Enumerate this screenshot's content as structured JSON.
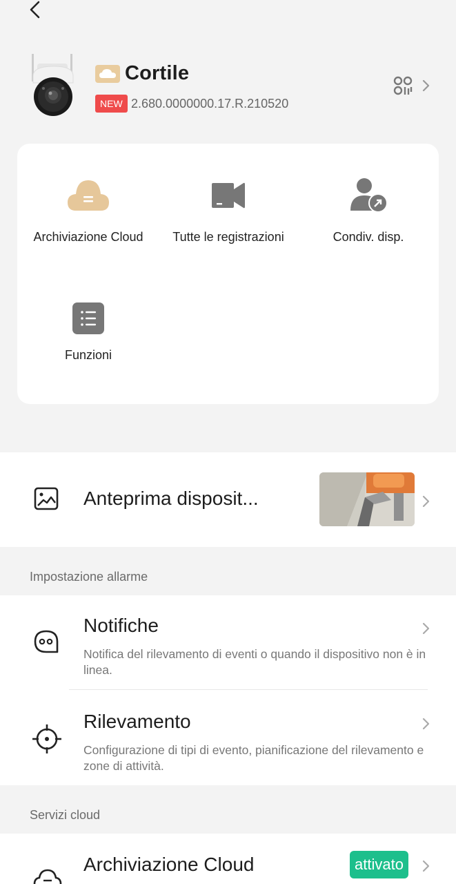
{
  "header": {
    "device_name": "Cortile",
    "new_badge": "NEW",
    "firmware_version": "2.680.0000000.17.R.210520"
  },
  "features": [
    {
      "label": "Archiviazione Cloud",
      "icon": "cloud-icon"
    },
    {
      "label": "Tutte le registrazioni",
      "icon": "video-icon"
    },
    {
      "label": "Condiv. disp.",
      "icon": "share-user-icon"
    },
    {
      "label": "Funzioni",
      "icon": "list-icon"
    }
  ],
  "preview": {
    "label": "Anteprima disposit..."
  },
  "alarm_section": {
    "title": "Impostazione allarme",
    "items": [
      {
        "title": "Notifiche",
        "subtitle": "Notifica del rilevamento di eventi o quando il dispositivo non è in linea.",
        "icon": "chat-face-icon"
      },
      {
        "title": "Rilevamento",
        "subtitle": "Configurazione di tipi di evento, pianificazione del rilevamento e zone di attività.",
        "icon": "crosshair-icon"
      }
    ]
  },
  "cloud_section": {
    "title": "Servizi cloud",
    "items": [
      {
        "title": "Archiviazione Cloud",
        "status": "attivato",
        "icon": "cloud-outline-icon"
      }
    ]
  },
  "colors": {
    "new_badge": "#ef4b4b",
    "activated_badge": "#1dbf8c",
    "cloud_accent": "#e5c79d"
  }
}
